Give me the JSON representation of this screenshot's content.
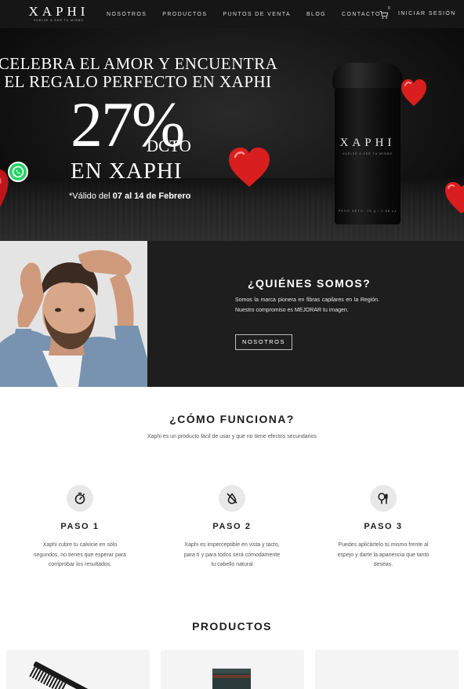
{
  "nav": {
    "logo": "XAPHI",
    "logo_tagline": "VUELVE A SER TU MISMO",
    "links": [
      "NOSOTROS",
      "PRODUCTOS",
      "PUNTOS DE VENTA",
      "BLOG",
      "CONTACTO"
    ],
    "cart_count": "0",
    "login": "INICIAR SESIÓN"
  },
  "hero": {
    "line1": "CELEBRA EL AMOR Y ENCUENTRA",
    "line2": "EL REGALO PERFECTO EN XAPHI",
    "discount": "27%",
    "dcto": "DCTO",
    "en_xaphi": "EN XAPHI",
    "valid_prefix": "*Válido del ",
    "valid_dates": "07 al 14 de Febrero",
    "product_brand": "XAPHI",
    "product_tagline": "VUELVE A SER TU MISMO",
    "product_net": "PESO NETO: 25 g / 0.88 oz",
    "accent_red": "#d81e1e"
  },
  "about": {
    "title": "¿QUIÉNES SOMOS?",
    "text": "Somos la marca pionera en fibras capilares en la Región. Nuestro compromiso es MEJORAR tu imagen.",
    "button": "NOSOTROS"
  },
  "how": {
    "title": "¿CÓMO FUNCIONA?",
    "subtitle": "Xaphi es un producto fácil de usar y que no tiene efectos secundarios",
    "steps": [
      {
        "icon": "stopwatch-icon",
        "label": "PASO 1",
        "text": "Xaphi cubre tu calvicie en sólo segundos, no tienes que esperar para comprobar los resultados."
      },
      {
        "icon": "eye-slash-icon",
        "label": "PASO 2",
        "text": "Xaphi es imperceptible en vista y tacto, para tí y para todos será cómodamente tu cabello natural"
      },
      {
        "icon": "mirror-brush-icon",
        "label": "PASO 3",
        "text": "Puedes aplicártelo tú mismo frente al espejo y darte la apariencia que tanto deseas."
      }
    ]
  },
  "products": {
    "title": "PRODUCTOS"
  }
}
